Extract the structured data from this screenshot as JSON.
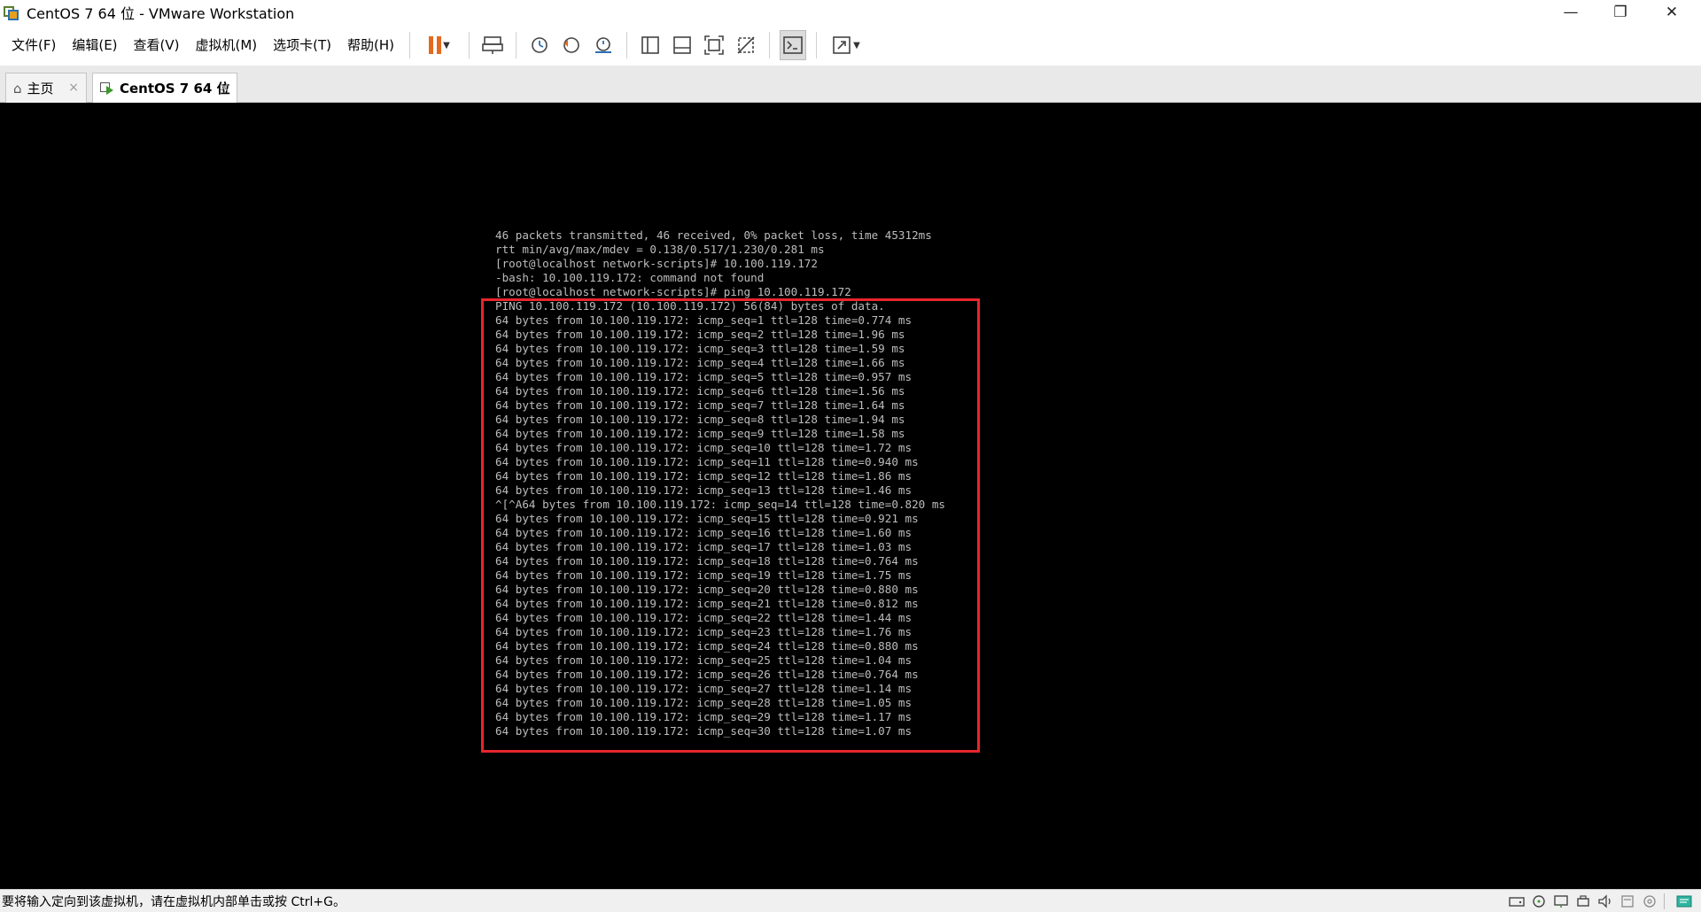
{
  "window": {
    "title": "CentOS 7 64 位 - VMware Workstation",
    "controls": {
      "minimize": "—",
      "restore": "❐",
      "close": "✕"
    }
  },
  "menu": {
    "items": [
      {
        "label": "文件(F)"
      },
      {
        "label": "编辑(E)"
      },
      {
        "label": "查看(V)"
      },
      {
        "label": "虚拟机(M)"
      },
      {
        "label": "选项卡(T)"
      },
      {
        "label": "帮助(H)"
      }
    ]
  },
  "toolbar": {
    "icons": [
      "pause-icon",
      "send-ctrl-alt-del-icon",
      "snapshot-icon",
      "revert-snapshot-icon",
      "snapshot-manager-icon",
      "show-library-icon",
      "show-thumbnail-icon",
      "full-screen-icon",
      "unity-icon",
      "console-view-icon",
      "stretch-guest-icon"
    ],
    "accent_color": "#e46a1e"
  },
  "tabs": [
    {
      "label": "主页",
      "close": "×"
    },
    {
      "label": "CentOS 7 64 位",
      "close": "×"
    }
  ],
  "terminal": {
    "lines": [
      "46 packets transmitted, 46 received, 0% packet loss, time 45312ms",
      "rtt min/avg/max/mdev = 0.138/0.517/1.230/0.281 ms",
      "[root@localhost network-scripts]# 10.100.119.172",
      "-bash: 10.100.119.172: command not found",
      "[root@localhost network-scripts]# ping 10.100.119.172",
      "PING 10.100.119.172 (10.100.119.172) 56(84) bytes of data.",
      "64 bytes from 10.100.119.172: icmp_seq=1 ttl=128 time=0.774 ms",
      "64 bytes from 10.100.119.172: icmp_seq=2 ttl=128 time=1.96 ms",
      "64 bytes from 10.100.119.172: icmp_seq=3 ttl=128 time=1.59 ms",
      "64 bytes from 10.100.119.172: icmp_seq=4 ttl=128 time=1.66 ms",
      "64 bytes from 10.100.119.172: icmp_seq=5 ttl=128 time=0.957 ms",
      "64 bytes from 10.100.119.172: icmp_seq=6 ttl=128 time=1.56 ms",
      "64 bytes from 10.100.119.172: icmp_seq=7 ttl=128 time=1.64 ms",
      "64 bytes from 10.100.119.172: icmp_seq=8 ttl=128 time=1.94 ms",
      "64 bytes from 10.100.119.172: icmp_seq=9 ttl=128 time=1.58 ms",
      "64 bytes from 10.100.119.172: icmp_seq=10 ttl=128 time=1.72 ms",
      "64 bytes from 10.100.119.172: icmp_seq=11 ttl=128 time=0.940 ms",
      "64 bytes from 10.100.119.172: icmp_seq=12 ttl=128 time=1.86 ms",
      "64 bytes from 10.100.119.172: icmp_seq=13 ttl=128 time=1.46 ms",
      "^[^A64 bytes from 10.100.119.172: icmp_seq=14 ttl=128 time=0.820 ms",
      "64 bytes from 10.100.119.172: icmp_seq=15 ttl=128 time=0.921 ms",
      "64 bytes from 10.100.119.172: icmp_seq=16 ttl=128 time=1.60 ms",
      "64 bytes from 10.100.119.172: icmp_seq=17 ttl=128 time=1.03 ms",
      "64 bytes from 10.100.119.172: icmp_seq=18 ttl=128 time=0.764 ms",
      "64 bytes from 10.100.119.172: icmp_seq=19 ttl=128 time=1.75 ms",
      "64 bytes from 10.100.119.172: icmp_seq=20 ttl=128 time=0.880 ms",
      "64 bytes from 10.100.119.172: icmp_seq=21 ttl=128 time=0.812 ms",
      "64 bytes from 10.100.119.172: icmp_seq=22 ttl=128 time=1.44 ms",
      "64 bytes from 10.100.119.172: icmp_seq=23 ttl=128 time=1.76 ms",
      "64 bytes from 10.100.119.172: icmp_seq=24 ttl=128 time=0.880 ms",
      "64 bytes from 10.100.119.172: icmp_seq=25 ttl=128 time=1.04 ms",
      "64 bytes from 10.100.119.172: icmp_seq=26 ttl=128 time=0.764 ms",
      "64 bytes from 10.100.119.172: icmp_seq=27 ttl=128 time=1.14 ms",
      "64 bytes from 10.100.119.172: icmp_seq=28 ttl=128 time=1.05 ms",
      "64 bytes from 10.100.119.172: icmp_seq=29 ttl=128 time=1.17 ms",
      "64 bytes from 10.100.119.172: icmp_seq=30 ttl=128 time=1.07 ms"
    ],
    "text_color": "#bdbdbd",
    "highlight_color": "#e8262c"
  },
  "status": {
    "message": "要将输入定向到该虚拟机，请在虚拟机内部单击或按 Ctrl+G。",
    "icons": [
      "hard-disk-icon",
      "cd-dvd-icon",
      "network-adapter-icon",
      "usb-icon",
      "sound-icon",
      "printer-icon",
      "display-icon",
      "message-icon"
    ]
  }
}
